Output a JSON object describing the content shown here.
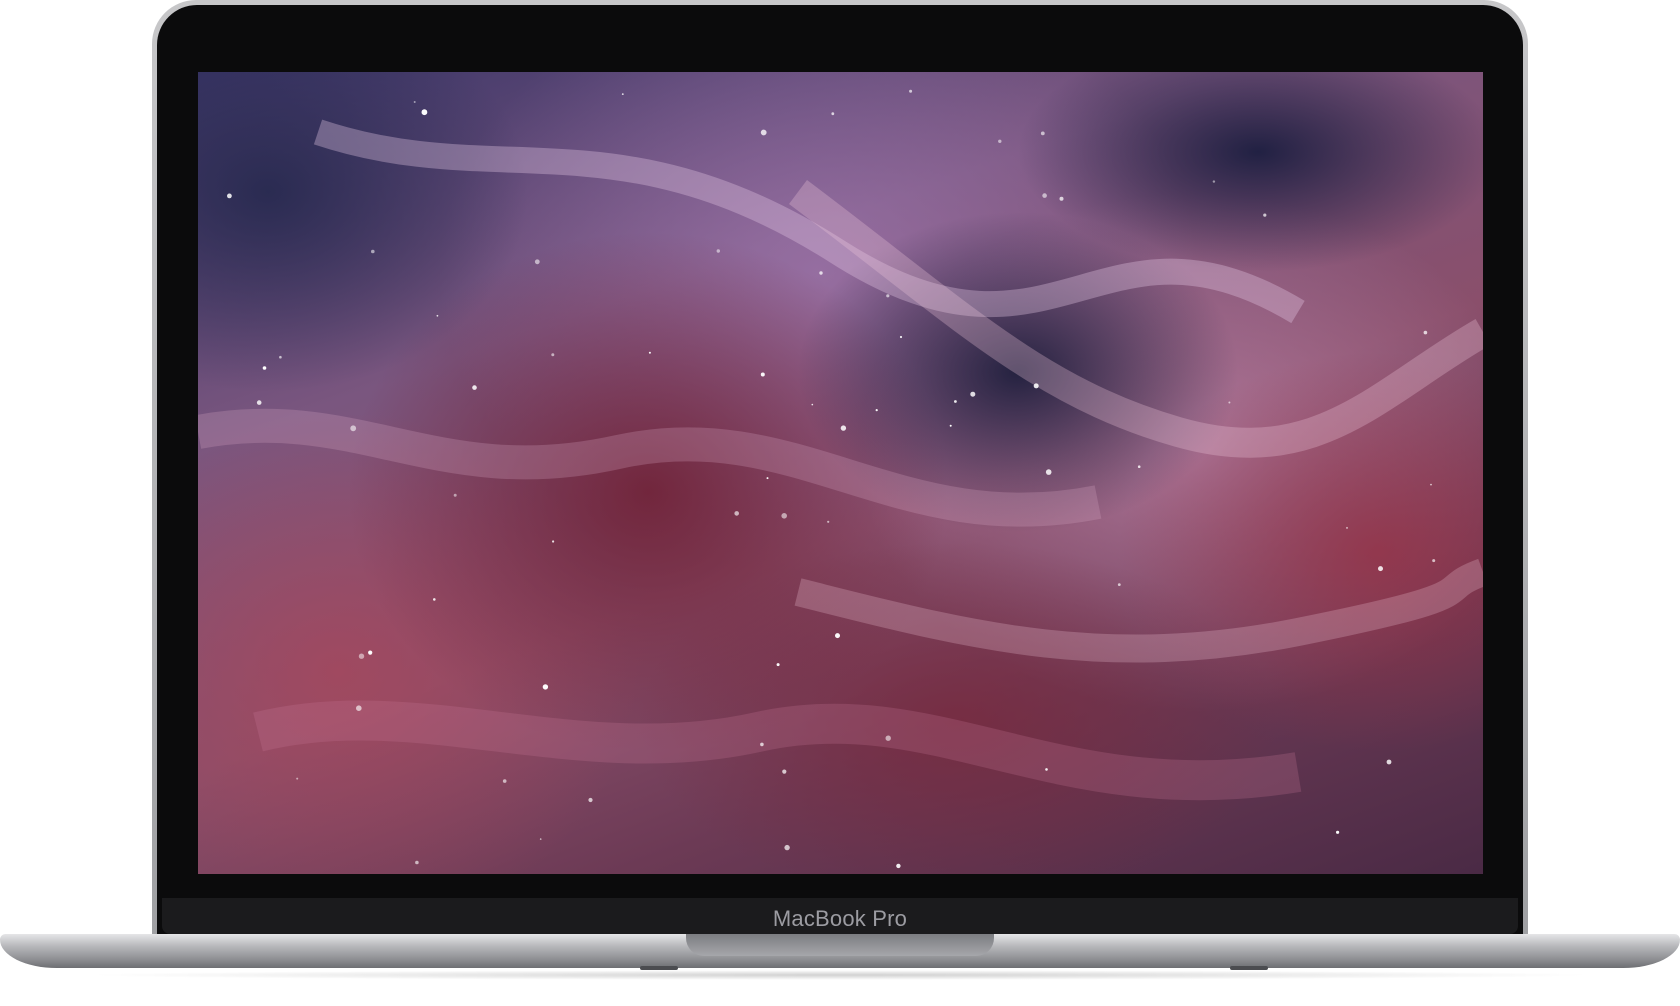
{
  "device": {
    "model_label": "MacBook Pro",
    "frame_color": "#9fa0a3",
    "bezel_color": "#0b0b0c"
  },
  "screen": {
    "wallpaper": "purple-nebula-wallpaper",
    "accent_colors": [
      "#3b3668",
      "#7a567f",
      "#8a4f6b",
      "#c896b8"
    ]
  }
}
